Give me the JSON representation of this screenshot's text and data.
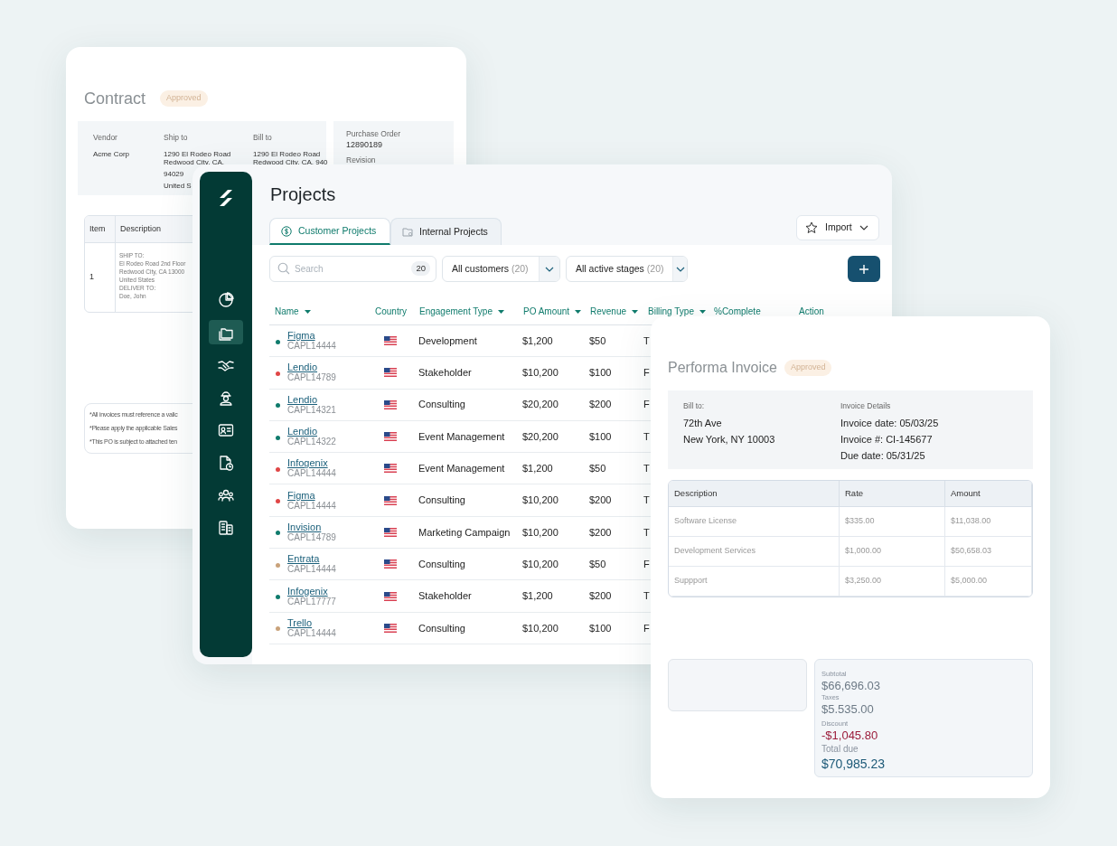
{
  "contract": {
    "title": "Contract",
    "status": "Approved",
    "fields": [
      {
        "label": "Vendor",
        "lines": [
          "Acme Corp"
        ]
      },
      {
        "label": "Ship to",
        "lines": [
          "1290 El Rodeo Road",
          "Redwood City, CA,",
          "94029",
          "United S"
        ]
      },
      {
        "label": "Bill to",
        "lines": [
          "1290 El Rodeo Road",
          "Redwood City, CA, 940"
        ]
      }
    ],
    "order": {
      "label": "Purchase Order",
      "value": "12890189",
      "next_label": "Revision"
    },
    "table": {
      "columns": [
        "Item",
        "Description"
      ],
      "rows": [
        {
          "item": "1",
          "lines": [
            "SHIP TO:",
            "El Rodeo Road 2nd Floor",
            "Redwood City, CA 13000",
            "United States",
            "DELIVER TO:",
            "Doe, John"
          ]
        }
      ]
    },
    "notes": [
      "*All invoices must reference a valic",
      "*Please apply the applicable Sales",
      "*This PO is subject to attached ten"
    ]
  },
  "projects": {
    "title": "Projects",
    "sidebar": {
      "items": [
        {
          "selected": false
        },
        {
          "selected": true
        },
        {
          "selected": false
        },
        {
          "selected": false
        },
        {
          "selected": false
        },
        {
          "selected": false
        },
        {
          "selected": false
        },
        {
          "selected": false
        }
      ]
    },
    "tabs": [
      {
        "label": "Customer Projects",
        "selected": true
      },
      {
        "label": "Internal Projects",
        "selected": false
      }
    ],
    "import_button": "Import",
    "search": {
      "placeholder": "Search",
      "count": "20"
    },
    "filters": [
      {
        "label": "All customers",
        "count": "(20)"
      },
      {
        "label": "All active stages",
        "count": "(20)"
      }
    ],
    "table": {
      "columns": [
        {
          "label": "Name",
          "sortable": true
        },
        {
          "label": "Country",
          "sortable": false
        },
        {
          "label": "Engagement Type",
          "sortable": true
        },
        {
          "label": "PO Amount",
          "sortable": true
        },
        {
          "label": "Revenue",
          "sortable": true
        },
        {
          "label": "Billing Type",
          "sortable": true
        },
        {
          "label": "%Complete",
          "sortable": false
        },
        {
          "label": "Action",
          "sortable": false
        }
      ],
      "rows": [
        {
          "name": "Figma",
          "code": "CAPL14444",
          "color": "#0f7b6c",
          "engagement": "Development",
          "po_amount": "$1,200",
          "revenue": "$50",
          "billing": "T"
        },
        {
          "name": "Lendio",
          "code": "CAPL14789",
          "color": "#e04646",
          "engagement": "Stakeholder",
          "po_amount": "$10,200",
          "revenue": "$100",
          "billing": "F"
        },
        {
          "name": "Lendio",
          "code": "CAPL14321",
          "color": "#0f7b6c",
          "engagement": "Consulting",
          "po_amount": "$20,200",
          "revenue": "$200",
          "billing": "F"
        },
        {
          "name": "Lendio",
          "code": "CAPL14322",
          "color": "#0f7b6c",
          "engagement": "Event Management",
          "po_amount": "$20,200",
          "revenue": "$100",
          "billing": "T"
        },
        {
          "name": "Infogenix",
          "code": "CAPL14444",
          "color": "#e04646",
          "engagement": "Event Management",
          "po_amount": "$1,200",
          "revenue": "$50",
          "billing": "T"
        },
        {
          "name": "Figma",
          "code": "CAPL14444",
          "color": "#e04646",
          "engagement": "Consulting",
          "po_amount": "$10,200",
          "revenue": "$200",
          "billing": "T"
        },
        {
          "name": "Invision",
          "code": "CAPL14789",
          "color": "#0f7b6c",
          "engagement": "Marketing Campaign",
          "po_amount": "$10,200",
          "revenue": "$200",
          "billing": "T"
        },
        {
          "name": "Entrata",
          "code": "CAPL14444",
          "color": "#c9a27a",
          "engagement": "Consulting",
          "po_amount": "$10,200",
          "revenue": "$50",
          "billing": "F"
        },
        {
          "name": "Infogenix",
          "code": "CAPL17777",
          "color": "#0f7b6c",
          "engagement": "Stakeholder",
          "po_amount": "$1,200",
          "revenue": "$200",
          "billing": "T"
        },
        {
          "name": "Trello",
          "code": "CAPL14444",
          "color": "#c9a27a",
          "engagement": "Consulting",
          "po_amount": "$10,200",
          "revenue": "$100",
          "billing": "F"
        }
      ]
    }
  },
  "invoice": {
    "title": "Performa Invoice",
    "status": "Approved",
    "bill_to": {
      "label": "Bill to:",
      "lines": [
        "72th Ave",
        "New York, NY 10003"
      ]
    },
    "details": {
      "label": "Invoice Details",
      "lines": [
        "Invoice date: 05/03/25",
        "Invoice #: CI-145677",
        "Due date: 05/31/25"
      ]
    },
    "table": {
      "columns": [
        "Description",
        "Rate",
        "Amount"
      ],
      "rows": [
        [
          "Software License",
          "$335.00",
          "$11,038.00"
        ],
        [
          "Development Services",
          "$1,000.00",
          "$50,658.03"
        ],
        [
          "Suppport",
          "$3,250.00",
          "$5,000.00"
        ]
      ]
    },
    "totals": [
      {
        "label": "Subtotal",
        "value": "$66,696.03",
        "kind": "normal"
      },
      {
        "label": "Taxes",
        "value": "$5.535.00",
        "kind": "normal"
      },
      {
        "label": "Discount",
        "value": "-$1,045.80",
        "kind": "negative"
      },
      {
        "label": "Total due",
        "value": "$70,985.23",
        "kind": "total"
      }
    ]
  }
}
